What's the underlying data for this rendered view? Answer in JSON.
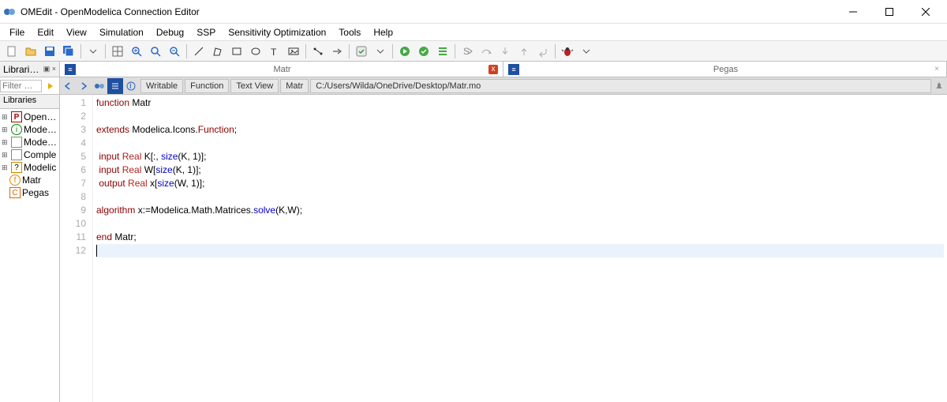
{
  "title": "OMEdit - OpenModelica Connection Editor",
  "menu": {
    "file": "File",
    "edit": "Edit",
    "view": "View",
    "simulation": "Simulation",
    "debug": "Debug",
    "ssp": "SSP",
    "sens": "Sensitivity Optimization",
    "tools": "Tools",
    "help": "Help"
  },
  "sidebar": {
    "header": "Librari…",
    "filter_placeholder": "Filter …",
    "section": "Libraries",
    "items": [
      {
        "icon": "P",
        "label": "Open…"
      },
      {
        "icon": "i",
        "label": "Mode…"
      },
      {
        "icon": "□",
        "label": "Mode…"
      },
      {
        "icon": "□",
        "label": "Comple"
      },
      {
        "icon": "?",
        "label": "Modelic"
      },
      {
        "icon": "f",
        "label": "Matr"
      },
      {
        "icon": "C",
        "label": "Pegas"
      }
    ]
  },
  "tabs": [
    {
      "label": "Matr",
      "close": "x",
      "close_color": "#d04020"
    },
    {
      "label": "Pegas",
      "close": "×",
      "close_color": "#999"
    }
  ],
  "crumbs": {
    "writable": "Writable",
    "function": "Function",
    "view": "Text View",
    "model": "Matr",
    "path": "C:/Users/Wilda/OneDrive/Desktop/Matr.mo"
  },
  "code": {
    "line_count": 12,
    "lines": [
      {
        "seg": [
          {
            "t": "function",
            "c": "kw"
          },
          {
            "t": " Matr"
          }
        ]
      },
      {
        "seg": []
      },
      {
        "seg": [
          {
            "t": "extends",
            "c": "kw"
          },
          {
            "t": " Modelica.Icons."
          },
          {
            "t": "Function",
            "c": "kw"
          },
          {
            "t": ";"
          }
        ]
      },
      {
        "seg": []
      },
      {
        "seg": [
          {
            "t": " input ",
            "c": "kw"
          },
          {
            "t": "Real ",
            "c": "ty"
          },
          {
            "t": "K[:, "
          },
          {
            "t": "size",
            "c": "fn"
          },
          {
            "t": "(K, 1)];"
          }
        ]
      },
      {
        "seg": [
          {
            "t": " input ",
            "c": "kw"
          },
          {
            "t": "Real ",
            "c": "ty"
          },
          {
            "t": "W["
          },
          {
            "t": "size",
            "c": "fn"
          },
          {
            "t": "(K, 1)];"
          }
        ]
      },
      {
        "seg": [
          {
            "t": " output ",
            "c": "kw"
          },
          {
            "t": "Real ",
            "c": "ty"
          },
          {
            "t": "x["
          },
          {
            "t": "size",
            "c": "fn"
          },
          {
            "t": "(W, 1)];"
          }
        ]
      },
      {
        "seg": []
      },
      {
        "seg": [
          {
            "t": "algorithm",
            "c": "kw"
          },
          {
            "t": " x:=Modelica.Math.Matrices."
          },
          {
            "t": "solve",
            "c": "fn"
          },
          {
            "t": "(K,W);"
          }
        ]
      },
      {
        "seg": []
      },
      {
        "seg": [
          {
            "t": "end",
            "c": "kw"
          },
          {
            "t": " Matr;"
          }
        ]
      },
      {
        "seg": [],
        "cursor": true
      }
    ]
  }
}
